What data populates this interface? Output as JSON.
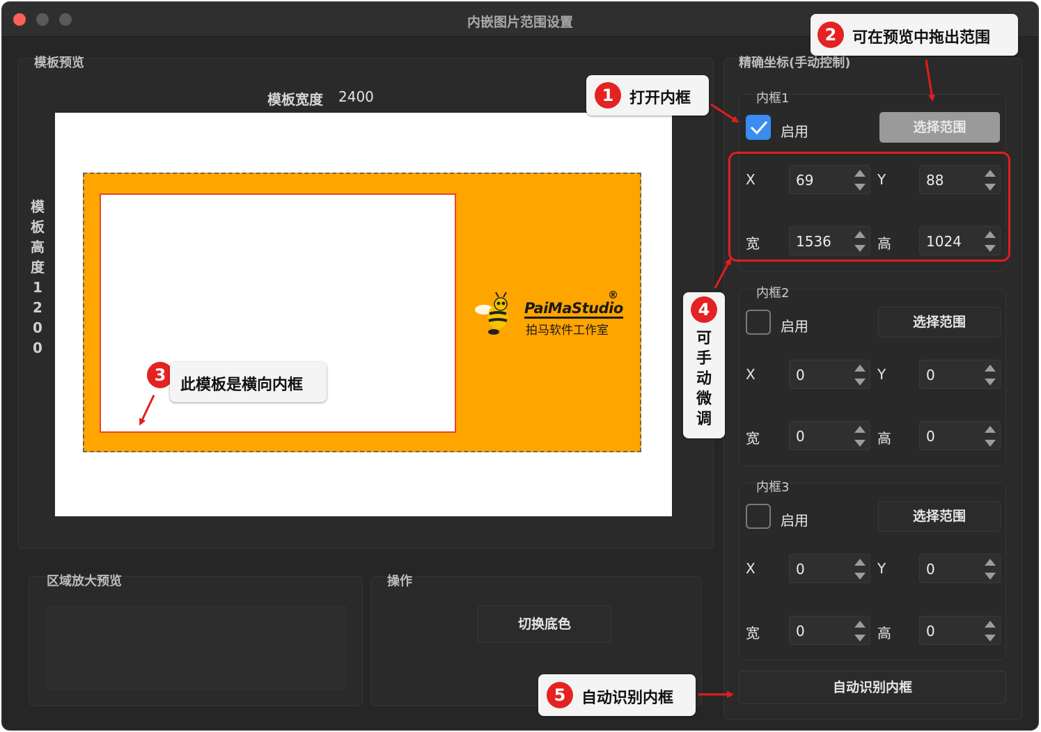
{
  "window": {
    "title": "内嵌图片范围设置"
  },
  "template_preview": {
    "label": "模板预览",
    "width_label": "模板宽度",
    "width_value": "2400",
    "height_label_chars": [
      "模",
      "板",
      "高",
      "度",
      "1",
      "2",
      "0",
      "0"
    ],
    "logo": {
      "brand": "PaiMaStudio",
      "registered": "®",
      "brand_cn": "拍马软件工作室"
    }
  },
  "zoom_preview": {
    "label": "区域放大预览"
  },
  "operations": {
    "label": "操作",
    "toggle_bg_button": "切换底色"
  },
  "precise": {
    "label": "精确坐标(手动控制)",
    "frames": [
      {
        "title": "内框1",
        "enabled": true,
        "enable_label": "启用",
        "select_button": "选择范围",
        "x_label": "X",
        "x": "69",
        "y_label": "Y",
        "y": "88",
        "w_label": "宽",
        "w": "1536",
        "h_label": "高",
        "h": "1024"
      },
      {
        "title": "内框2",
        "enabled": false,
        "enable_label": "启用",
        "select_button": "选择范围",
        "x_label": "X",
        "x": "0",
        "y_label": "Y",
        "y": "0",
        "w_label": "宽",
        "w": "0",
        "h_label": "高",
        "h": "0"
      },
      {
        "title": "内框3",
        "enabled": false,
        "enable_label": "启用",
        "select_button": "选择范围",
        "x_label": "X",
        "x": "0",
        "y_label": "Y",
        "y": "0",
        "w_label": "宽",
        "w": "0",
        "h_label": "高",
        "h": "0"
      }
    ],
    "auto_detect_button": "自动识别内框"
  },
  "callouts": {
    "c1": {
      "num": "1",
      "text": "打开内框"
    },
    "c2": {
      "num": "2",
      "text": "可在预览中拖出范围"
    },
    "c3": {
      "num": "3",
      "text": "此模板是横向内框"
    },
    "c4": {
      "num": "4",
      "text_chars": [
        "可",
        "手",
        "动",
        "微",
        "调"
      ]
    },
    "c5": {
      "num": "5",
      "text": "自动识别内框"
    }
  },
  "colors": {
    "accent_blue": "#3b8cf0",
    "annotation_red": "#e52222",
    "template_orange": "#ffa500"
  }
}
